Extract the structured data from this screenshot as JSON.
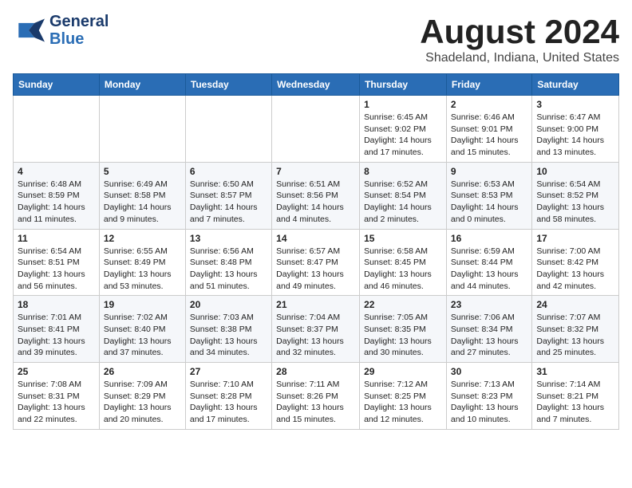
{
  "header": {
    "logo_general": "General",
    "logo_blue": "Blue",
    "main_title": "August 2024",
    "subtitle": "Shadeland, Indiana, United States"
  },
  "calendar": {
    "days_of_week": [
      "Sunday",
      "Monday",
      "Tuesday",
      "Wednesday",
      "Thursday",
      "Friday",
      "Saturday"
    ],
    "weeks": [
      [
        {
          "day": "",
          "info": ""
        },
        {
          "day": "",
          "info": ""
        },
        {
          "day": "",
          "info": ""
        },
        {
          "day": "",
          "info": ""
        },
        {
          "day": "1",
          "info": "Sunrise: 6:45 AM\nSunset: 9:02 PM\nDaylight: 14 hours\nand 17 minutes."
        },
        {
          "day": "2",
          "info": "Sunrise: 6:46 AM\nSunset: 9:01 PM\nDaylight: 14 hours\nand 15 minutes."
        },
        {
          "day": "3",
          "info": "Sunrise: 6:47 AM\nSunset: 9:00 PM\nDaylight: 14 hours\nand 13 minutes."
        }
      ],
      [
        {
          "day": "4",
          "info": "Sunrise: 6:48 AM\nSunset: 8:59 PM\nDaylight: 14 hours\nand 11 minutes."
        },
        {
          "day": "5",
          "info": "Sunrise: 6:49 AM\nSunset: 8:58 PM\nDaylight: 14 hours\nand 9 minutes."
        },
        {
          "day": "6",
          "info": "Sunrise: 6:50 AM\nSunset: 8:57 PM\nDaylight: 14 hours\nand 7 minutes."
        },
        {
          "day": "7",
          "info": "Sunrise: 6:51 AM\nSunset: 8:56 PM\nDaylight: 14 hours\nand 4 minutes."
        },
        {
          "day": "8",
          "info": "Sunrise: 6:52 AM\nSunset: 8:54 PM\nDaylight: 14 hours\nand 2 minutes."
        },
        {
          "day": "9",
          "info": "Sunrise: 6:53 AM\nSunset: 8:53 PM\nDaylight: 14 hours\nand 0 minutes."
        },
        {
          "day": "10",
          "info": "Sunrise: 6:54 AM\nSunset: 8:52 PM\nDaylight: 13 hours\nand 58 minutes."
        }
      ],
      [
        {
          "day": "11",
          "info": "Sunrise: 6:54 AM\nSunset: 8:51 PM\nDaylight: 13 hours\nand 56 minutes."
        },
        {
          "day": "12",
          "info": "Sunrise: 6:55 AM\nSunset: 8:49 PM\nDaylight: 13 hours\nand 53 minutes."
        },
        {
          "day": "13",
          "info": "Sunrise: 6:56 AM\nSunset: 8:48 PM\nDaylight: 13 hours\nand 51 minutes."
        },
        {
          "day": "14",
          "info": "Sunrise: 6:57 AM\nSunset: 8:47 PM\nDaylight: 13 hours\nand 49 minutes."
        },
        {
          "day": "15",
          "info": "Sunrise: 6:58 AM\nSunset: 8:45 PM\nDaylight: 13 hours\nand 46 minutes."
        },
        {
          "day": "16",
          "info": "Sunrise: 6:59 AM\nSunset: 8:44 PM\nDaylight: 13 hours\nand 44 minutes."
        },
        {
          "day": "17",
          "info": "Sunrise: 7:00 AM\nSunset: 8:42 PM\nDaylight: 13 hours\nand 42 minutes."
        }
      ],
      [
        {
          "day": "18",
          "info": "Sunrise: 7:01 AM\nSunset: 8:41 PM\nDaylight: 13 hours\nand 39 minutes."
        },
        {
          "day": "19",
          "info": "Sunrise: 7:02 AM\nSunset: 8:40 PM\nDaylight: 13 hours\nand 37 minutes."
        },
        {
          "day": "20",
          "info": "Sunrise: 7:03 AM\nSunset: 8:38 PM\nDaylight: 13 hours\nand 34 minutes."
        },
        {
          "day": "21",
          "info": "Sunrise: 7:04 AM\nSunset: 8:37 PM\nDaylight: 13 hours\nand 32 minutes."
        },
        {
          "day": "22",
          "info": "Sunrise: 7:05 AM\nSunset: 8:35 PM\nDaylight: 13 hours\nand 30 minutes."
        },
        {
          "day": "23",
          "info": "Sunrise: 7:06 AM\nSunset: 8:34 PM\nDaylight: 13 hours\nand 27 minutes."
        },
        {
          "day": "24",
          "info": "Sunrise: 7:07 AM\nSunset: 8:32 PM\nDaylight: 13 hours\nand 25 minutes."
        }
      ],
      [
        {
          "day": "25",
          "info": "Sunrise: 7:08 AM\nSunset: 8:31 PM\nDaylight: 13 hours\nand 22 minutes."
        },
        {
          "day": "26",
          "info": "Sunrise: 7:09 AM\nSunset: 8:29 PM\nDaylight: 13 hours\nand 20 minutes."
        },
        {
          "day": "27",
          "info": "Sunrise: 7:10 AM\nSunset: 8:28 PM\nDaylight: 13 hours\nand 17 minutes."
        },
        {
          "day": "28",
          "info": "Sunrise: 7:11 AM\nSunset: 8:26 PM\nDaylight: 13 hours\nand 15 minutes."
        },
        {
          "day": "29",
          "info": "Sunrise: 7:12 AM\nSunset: 8:25 PM\nDaylight: 13 hours\nand 12 minutes."
        },
        {
          "day": "30",
          "info": "Sunrise: 7:13 AM\nSunset: 8:23 PM\nDaylight: 13 hours\nand 10 minutes."
        },
        {
          "day": "31",
          "info": "Sunrise: 7:14 AM\nSunset: 8:21 PM\nDaylight: 13 hours\nand 7 minutes."
        }
      ]
    ]
  }
}
